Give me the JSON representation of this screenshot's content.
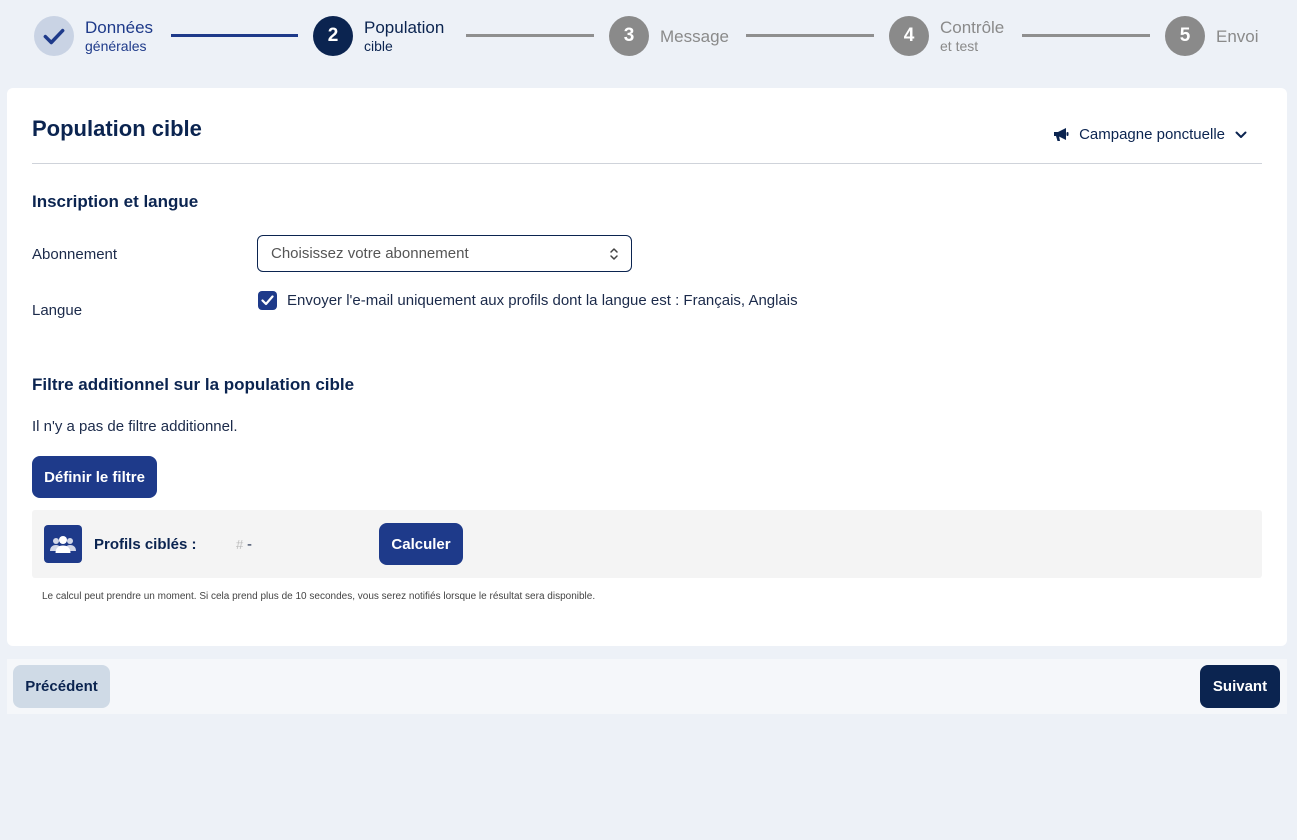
{
  "stepper": {
    "steps": [
      {
        "number": "",
        "label1": "Données",
        "label2": "générales",
        "state": "done"
      },
      {
        "number": "2",
        "label1": "Population",
        "label2": "cible",
        "state": "active"
      },
      {
        "number": "3",
        "label1": "Message",
        "label2": "",
        "state": "todo"
      },
      {
        "number": "4",
        "label1": "Contrôle",
        "label2": "et test",
        "state": "todo"
      },
      {
        "number": "5",
        "label1": "Envoi",
        "label2": "",
        "state": "todo"
      }
    ]
  },
  "header": {
    "title": "Population cible",
    "campaign_label": "Campagne ponctuelle"
  },
  "inscription": {
    "title": "Inscription et langue",
    "subscription_label": "Abonnement",
    "subscription_placeholder": "Choisissez votre abonnement",
    "language_label": "Langue",
    "language_checkbox_label": "Envoyer l'e-mail uniquement aux profils dont la langue est : Français, Anglais",
    "language_checked": true
  },
  "filter": {
    "title": "Filtre additionnel sur la population cible",
    "empty_text": "Il n'y a pas de filtre additionnel.",
    "define_button": "Définir le filtre"
  },
  "profiles": {
    "label": "Profils ciblés :",
    "hash": "#",
    "value": "-",
    "calculate_button": "Calculer",
    "note": "Le calcul peut prendre un moment. Si cela prend plus de 10 secondes, vous serez notifiés lorsque le résultat sera disponible."
  },
  "footer": {
    "previous_button": "Précédent",
    "next_button": "Suivant"
  },
  "colors": {
    "primary": "#1e3a8a",
    "dark": "#0b2450",
    "muted": "#8a8a8a",
    "background": "#edf1f7"
  }
}
